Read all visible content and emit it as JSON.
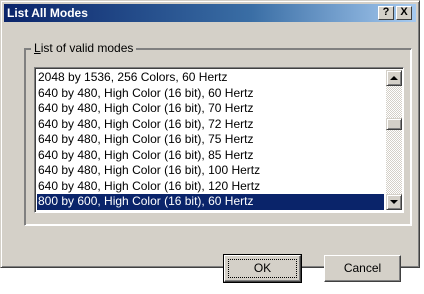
{
  "window": {
    "title": "List All Modes",
    "help_button": "?",
    "close_button": "X"
  },
  "group": {
    "label_accel": "L",
    "label_rest": "ist of valid modes"
  },
  "modes": [
    "2048 by 1536, 256 Colors, 60 Hertz",
    "640 by 480, High Color (16 bit), 60 Hertz",
    "640 by 480, High Color (16 bit), 70 Hertz",
    "640 by 480, High Color (16 bit), 72 Hertz",
    "640 by 480, High Color (16 bit), 75 Hertz",
    "640 by 480, High Color (16 bit), 85 Hertz",
    "640 by 480, High Color (16 bit), 100 Hertz",
    "640 by 480, High Color (16 bit), 120 Hertz",
    "800 by 600, High Color (16 bit), 60 Hertz"
  ],
  "selected_mode": "800 by 600, High Color (16 bit), 60 Hertz",
  "buttons": {
    "ok": "OK",
    "cancel": "Cancel"
  },
  "colors": {
    "selection": "#0a246a",
    "title_gradient_start": "#0a246a",
    "title_gradient_end": "#a6caf0",
    "face": "#d4d0c8"
  }
}
